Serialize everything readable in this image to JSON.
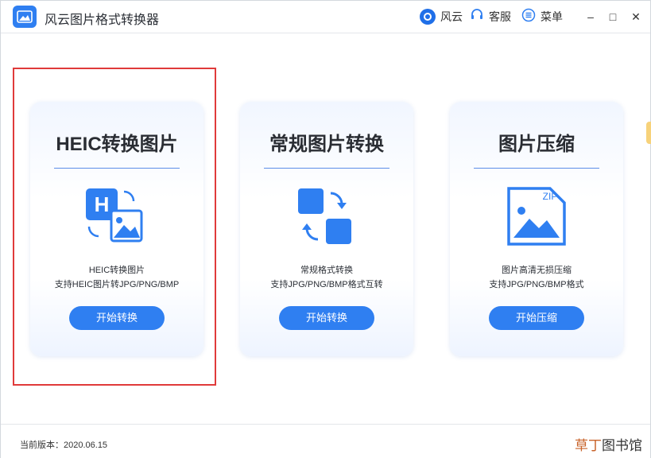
{
  "app": {
    "title": "风云图片格式转换器",
    "accent": "#2f7ff1"
  },
  "header": {
    "brand_label": "风云",
    "service_label": "客服",
    "menu_label": "菜单",
    "minimize": "–",
    "maximize": "□",
    "close": "✕"
  },
  "cards": [
    {
      "title": "HEIC转换图片",
      "desc1": "HEIC转换图片",
      "desc2": "支持HEIC图片转JPG/PNG/BMP",
      "button": "开始转换",
      "icon": "heic-convert-icon"
    },
    {
      "title": "常规图片转换",
      "desc1": "常规格式转换",
      "desc2": "支持JPG/PNG/BMP格式互转",
      "button": "开始转换",
      "icon": "format-convert-icon"
    },
    {
      "title": "图片压缩",
      "desc1": "图片高清无损压缩",
      "desc2": "支持JPG/PNG/BMP格式",
      "button": "开始压缩",
      "icon": "zip-compress-icon",
      "icon_badge": "ZIP"
    }
  ],
  "heic_letter": "H",
  "footer": {
    "version": "当前版本：2020.06.15",
    "watermark_accent": "草丁",
    "watermark_rest": "图书馆"
  },
  "colors": {
    "highlight": "#e03a3a",
    "button": "#2f7ff1"
  }
}
